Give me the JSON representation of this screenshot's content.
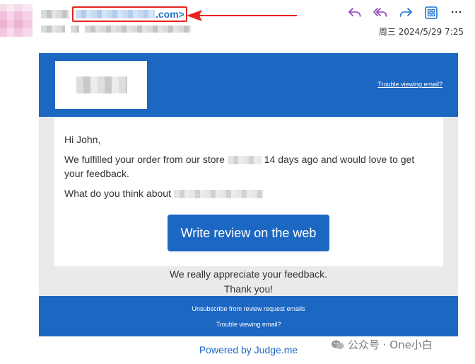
{
  "sender": {
    "domain_suffix": ".com>"
  },
  "toolbar": {
    "reply_icon": "reply-icon",
    "reply_all_icon": "reply-all-icon",
    "forward_icon": "forward-icon",
    "apps_icon": "apps-icon",
    "more_icon": "more-icon",
    "more_glyph": "···"
  },
  "date": "周三 2024/5/29 7:25",
  "email": {
    "trouble_link": "Trouble viewing email?",
    "greeting": "Hi John,",
    "paragraph_before": "We fulfilled your order from our store ",
    "paragraph_after": " 14 days ago and would love to get your feedback.",
    "question_prefix": "What do you think about ",
    "review_button": "Write review on the web",
    "appreciate_line": "We really appreciate your feedback.",
    "thanks_line": "Thank you!",
    "footer_unsubscribe": "Unsubscribe from review request emails",
    "footer_trouble": "Trouble viewing email?"
  },
  "powered_by": "Powered by Judge.me",
  "watermark": "公众号 · One小白",
  "colors": {
    "brand_blue": "#1c67c2",
    "highlight_red": "#e8231f",
    "background_gray": "#e9eaec"
  }
}
